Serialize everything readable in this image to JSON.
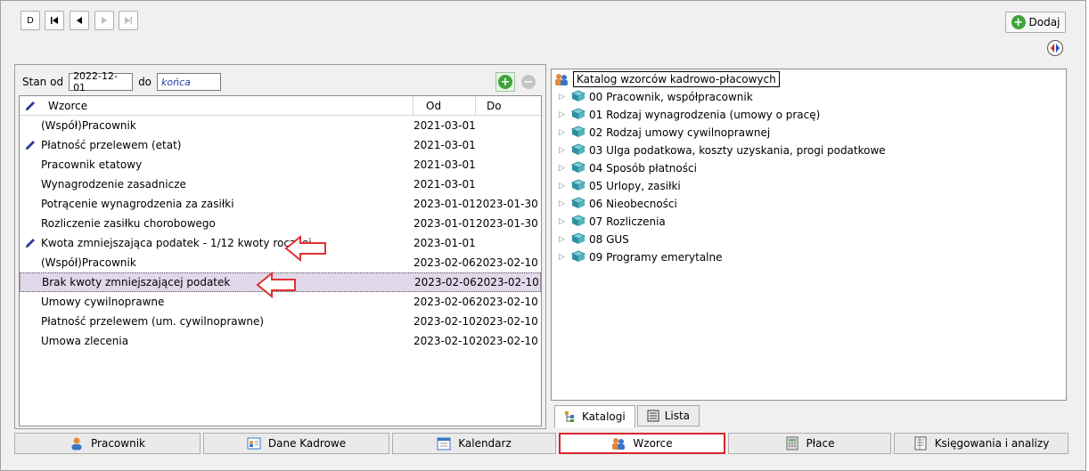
{
  "toolbar": {
    "nav": [
      "D",
      "|◀",
      "◀",
      "▶",
      "▶|"
    ],
    "add_label": "Dodaj"
  },
  "filter": {
    "stan_od_label": "Stan od",
    "stan_od_value": "2022-12-01",
    "do_label": "do",
    "do_value": "końca"
  },
  "grid": {
    "headers": {
      "name": "Wzorce",
      "od": "Od",
      "do": "Do"
    },
    "rows": [
      {
        "pen": false,
        "name": "(Współ)Pracownik",
        "od": "2021-03-01",
        "do": ""
      },
      {
        "pen": true,
        "name": "Płatność przelewem (etat)",
        "od": "2021-03-01",
        "do": ""
      },
      {
        "pen": false,
        "name": "Pracownik etatowy",
        "od": "2021-03-01",
        "do": ""
      },
      {
        "pen": false,
        "name": "Wynagrodzenie zasadnicze",
        "od": "2021-03-01",
        "do": ""
      },
      {
        "pen": false,
        "name": "Potrącenie wynagrodzenia za zasiłki",
        "od": "2023-01-01",
        "do": "2023-01-30"
      },
      {
        "pen": false,
        "name": "Rozliczenie zasiłku chorobowego",
        "od": "2023-01-01",
        "do": "2023-01-30"
      },
      {
        "pen": true,
        "name": "Kwota zmniejszająca podatek - 1/12 kwoty rocznej",
        "od": "2023-01-01",
        "do": ""
      },
      {
        "pen": false,
        "name": "(Współ)Pracownik",
        "od": "2023-02-06",
        "do": "2023-02-10"
      },
      {
        "pen": false,
        "name": "Brak kwoty zmniejszającej podatek",
        "od": "2023-02-06",
        "do": "2023-02-10"
      },
      {
        "pen": false,
        "name": "Umowy cywilnoprawne",
        "od": "2023-02-06",
        "do": "2023-02-10"
      },
      {
        "pen": false,
        "name": "Płatność przelewem (um. cywilnoprawne)",
        "od": "2023-02-10",
        "do": "2023-02-10"
      },
      {
        "pen": false,
        "name": "Umowa zlecenia",
        "od": "2023-02-10",
        "do": "2023-02-10"
      }
    ]
  },
  "tree": {
    "root": "Katalog wzorców kadrowo-płacowych",
    "items": [
      "00 Pracownik, współpracownik",
      "01 Rodzaj wynagrodzenia (umowy o pracę)",
      "02 Rodzaj umowy cywilnoprawnej",
      "03 Ulga podatkowa, koszty uzyskania, progi podatkowe",
      "04 Sposób płatności",
      "05 Urlopy, zasiłki",
      "06 Nieobecności",
      "07 Rozliczenia",
      "08 GUS",
      "09 Programy emerytalne"
    ]
  },
  "tabs": {
    "katalogi": "Katalogi",
    "lista": "Lista"
  },
  "bottom": {
    "pracownik": "Pracownik",
    "dane_kadrowe": "Dane Kadrowe",
    "kalendarz": "Kalendarz",
    "wzorce": "Wzorce",
    "place": "Płace",
    "ksiegowania": "Księgowania i analizy"
  },
  "colors": {
    "accent_red": "#d9252b",
    "selected_row": "#e2d8eb",
    "book_teal": "#2f8f9d"
  }
}
